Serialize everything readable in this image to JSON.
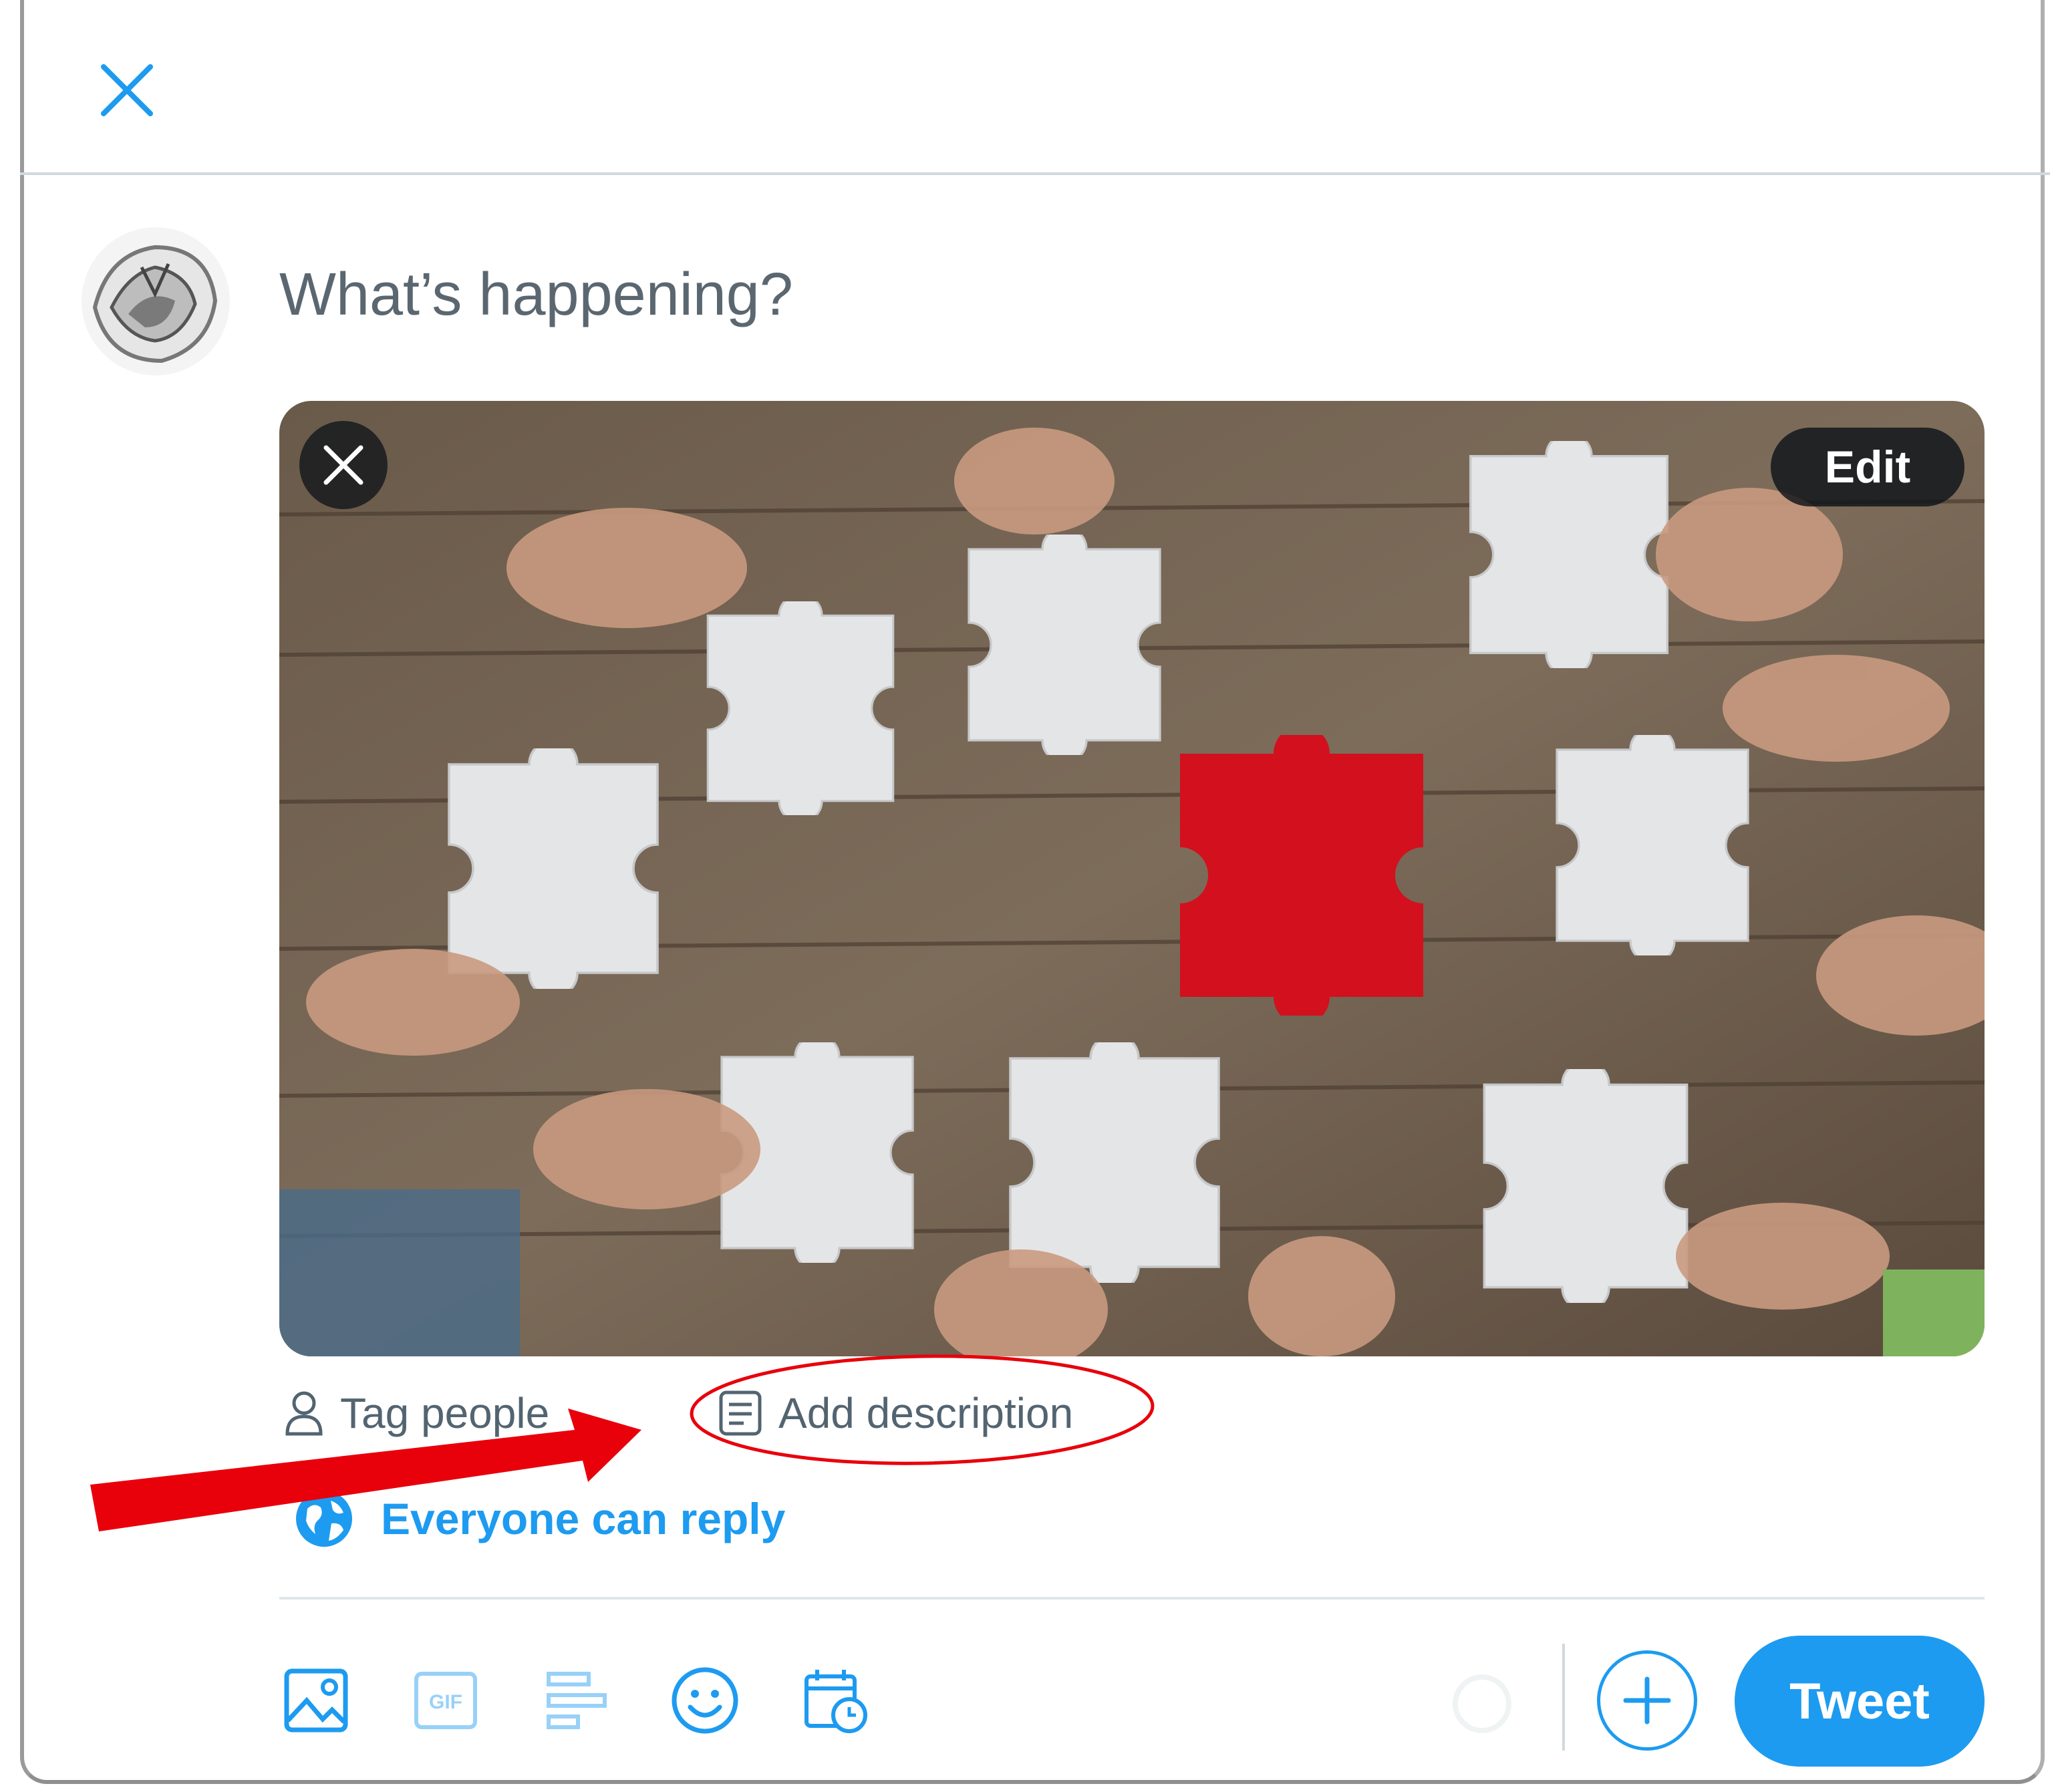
{
  "composer": {
    "placeholder": "What’s happening?"
  },
  "media": {
    "edit_label": "Edit",
    "alt": "puzzle-pieces-teamwork-photo"
  },
  "media_actions": {
    "tag_people": "Tag people",
    "add_description": "Add description"
  },
  "reply_setting": {
    "label": "Everyone can reply"
  },
  "toolbar": {
    "icons": [
      "image-icon",
      "gif-icon",
      "poll-icon",
      "emoji-icon",
      "schedule-icon"
    ],
    "gif_text": "GIF",
    "tweet_label": "Tweet"
  },
  "colors": {
    "accent": "#1d9bf0",
    "annotation": "#e8000b"
  }
}
